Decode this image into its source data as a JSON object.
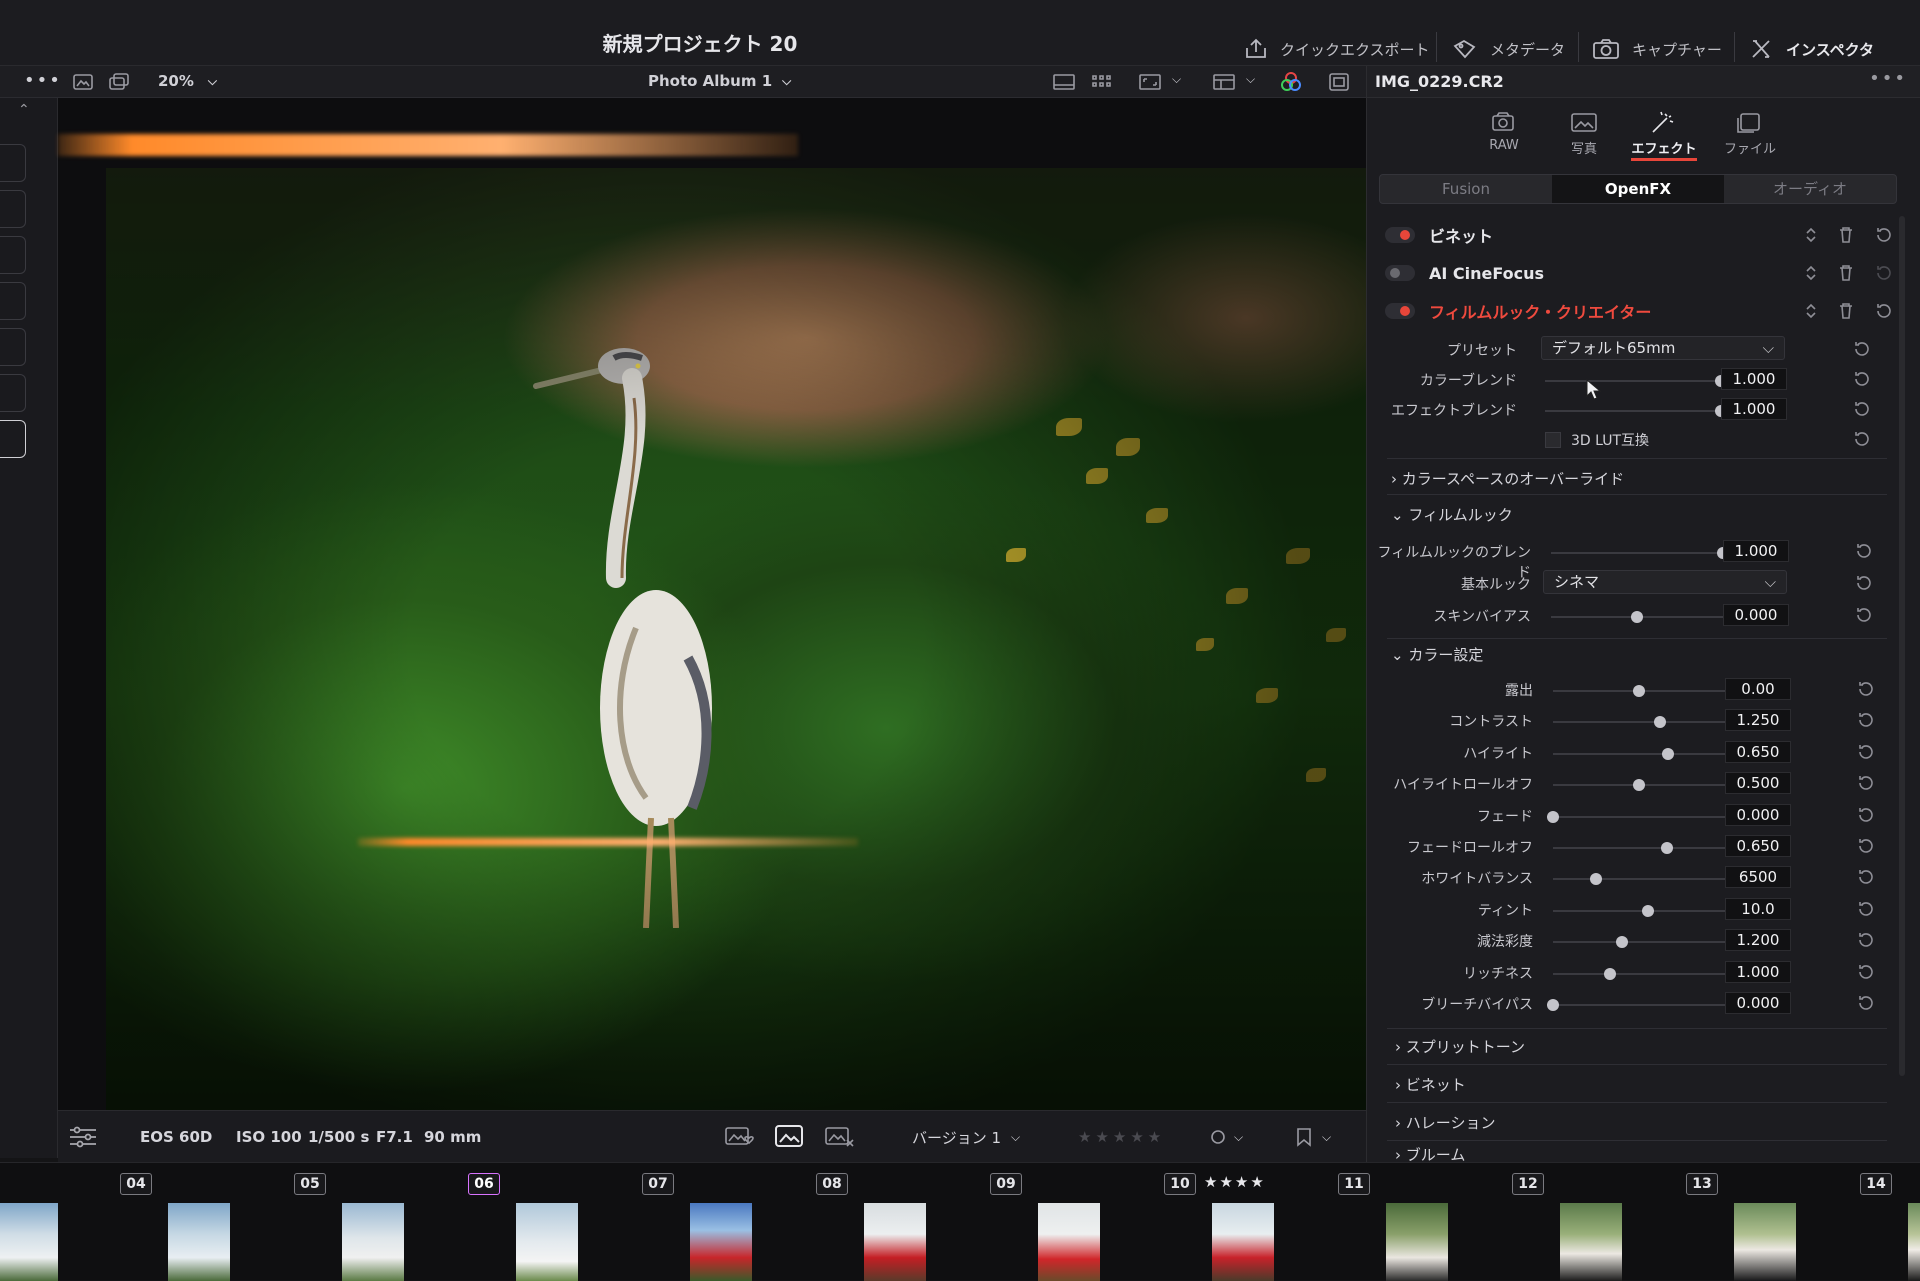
{
  "app": {
    "title": "新規プロジェクト 20",
    "top_actions": [
      {
        "label": "クイックエクスポート",
        "icon": "export-icon"
      },
      {
        "label": "メタデータ",
        "icon": "tag-icon"
      },
      {
        "label": "キャプチャー",
        "icon": "camera-icon"
      },
      {
        "label": "インスペクタ",
        "icon": "tools-icon"
      }
    ]
  },
  "toolbar": {
    "zoom": "20%",
    "album": "Photo Album 1",
    "file_name": "IMG_0229.CR2"
  },
  "inspector": {
    "tabs": [
      {
        "label": "RAW",
        "icon": "raw-icon",
        "active": false
      },
      {
        "label": "写真",
        "icon": "photo-icon",
        "active": false
      },
      {
        "label": "エフェクト",
        "icon": "magic-wand-icon",
        "active": true
      },
      {
        "label": "ファイル",
        "icon": "file-icon",
        "active": false
      }
    ],
    "segments": [
      {
        "label": "Fusion",
        "active": false
      },
      {
        "label": "OpenFX",
        "active": true
      },
      {
        "label": "オーディオ",
        "active": false
      }
    ],
    "effects": [
      {
        "name": "ビネット",
        "enabled": true,
        "accent": "#e8463a"
      },
      {
        "name": "AI CineFocus",
        "enabled": false,
        "accent": "#8a8a90"
      },
      {
        "name": "フィルムルック・クリエイター",
        "enabled": true,
        "accent": "#e8463a",
        "highlight": true
      }
    ],
    "preset": {
      "label": "プリセット",
      "value": "デフォルト65mm"
    },
    "color_blend": {
      "label": "カラーブレンド",
      "value": "1.000",
      "level": 1.0
    },
    "effect_blend": {
      "label": "エフェクトブレンド",
      "value": "1.000",
      "level": 1.0
    },
    "lut_checkbox": {
      "label": "3D LUT互換",
      "checked": false
    },
    "sections": {
      "colorspace": "カラースペースのオーバーライド",
      "filmlook": "フィルムルック",
      "color": "カラー設定",
      "split": "スプリットトーン",
      "vignette": "ビネット",
      "halation": "ハレーション",
      "bloom": "ブルーム"
    },
    "filmlook": {
      "blend": {
        "label": "フィルムルックのブレンド",
        "value": "1.000",
        "level": 1.0
      },
      "base_look": {
        "label": "基本ルック",
        "value": "シネマ"
      },
      "skin_bias": {
        "label": "スキンバイアス",
        "value": "0.000",
        "level": 0.5
      }
    },
    "color_params": [
      {
        "label": "露出",
        "value": "0.00",
        "level": 0.5
      },
      {
        "label": "コントラスト",
        "value": "1.250",
        "level": 0.62
      },
      {
        "label": "ハイライト",
        "value": "0.650",
        "level": 0.67
      },
      {
        "label": "ハイライトロールオフ",
        "value": "0.500",
        "level": 0.5
      },
      {
        "label": "フェード",
        "value": "0.000",
        "level": 0.0
      },
      {
        "label": "フェードロールオフ",
        "value": "0.650",
        "level": 0.66
      },
      {
        "label": "ホワイトバランス",
        "value": "6500",
        "level": 0.25
      },
      {
        "label": "ティント",
        "value": "10.0",
        "level": 0.55
      },
      {
        "label": "減法彩度",
        "value": "1.200",
        "level": 0.4
      },
      {
        "label": "リッチネス",
        "value": "1.000",
        "level": 0.33
      },
      {
        "label": "ブリーチバイパス",
        "value": "0.000",
        "level": 0.0
      }
    ]
  },
  "viewer_info": {
    "camera": "EOS 60D",
    "iso": "ISO 100",
    "shutter": "1/500 s",
    "aperture": "F7.1",
    "focal": "90 mm",
    "version": "バージョン 1",
    "rating_placeholder": "★★★★★"
  },
  "filmstrip": {
    "clips": [
      "04",
      "05",
      "06",
      "07",
      "08",
      "09",
      "10",
      "11",
      "12",
      "13",
      "14"
    ],
    "active_clip": "06",
    "clip10_stars": "★★★★"
  },
  "colors": {
    "accent_red": "#e8463a",
    "active_clip_border": "#d873ff"
  }
}
